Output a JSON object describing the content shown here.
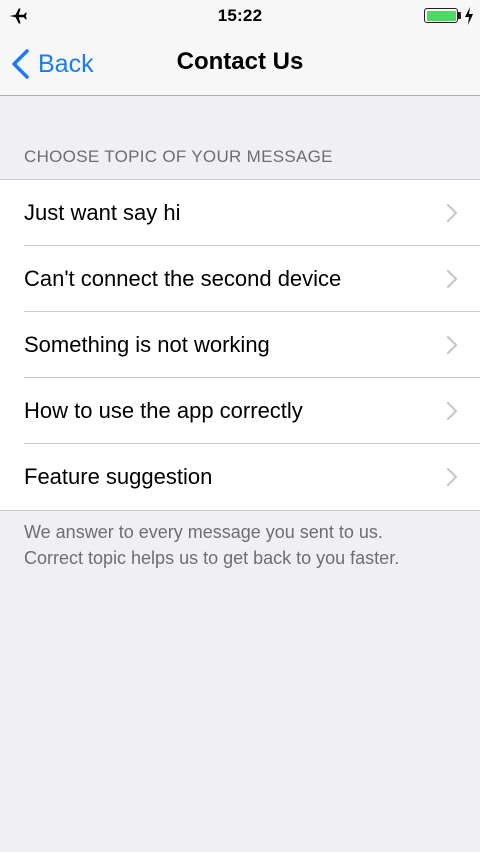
{
  "status_bar": {
    "time": "15:22",
    "left_icon": "airplane-icon",
    "battery_color": "#4cd964",
    "right_icon": "charging-bolt-icon"
  },
  "nav_bar": {
    "back_label": "Back",
    "title": "Contact Us",
    "accent_color": "#1a7cf5"
  },
  "section": {
    "header": "CHOOSE TOPIC OF YOUR MESSAGE",
    "items": [
      {
        "label": "Just want say hi"
      },
      {
        "label": "Can't connect the second device"
      },
      {
        "label": "Something is not working"
      },
      {
        "label": "How to use the app correctly"
      },
      {
        "label": "Feature suggestion"
      }
    ],
    "footer_line1": "We answer to every message you sent to us.",
    "footer_line2": "Correct topic helps us to get back to you faster."
  }
}
